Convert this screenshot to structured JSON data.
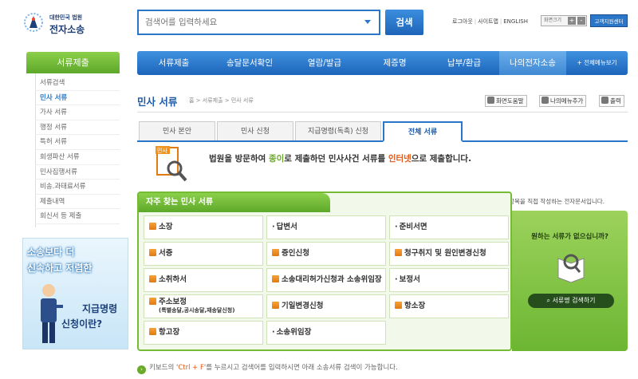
{
  "header": {
    "logo_top": "대한민국 법원",
    "logo_main": "전자소송",
    "search_placeholder": "검색어를 입력하세요",
    "search_button": "검색",
    "util_logout": "로그아웃",
    "util_sitemap": "사이트맵",
    "util_english": "ENGLISH",
    "font_size_label": "화면크기",
    "font_plus": "+",
    "font_minus": "-",
    "support_button": "고객지원센터"
  },
  "nav": {
    "items": [
      "서류제출",
      "송달문서확인",
      "열람/발급",
      "제증명",
      "납부/환급",
      "나의전자소송"
    ],
    "all_menu": "+ 전체메뉴보기"
  },
  "left_menu": {
    "title": "서류제출",
    "items": [
      "서류검색",
      "민사 서류",
      "가사 서류",
      "행정 서류",
      "특허 서류",
      "회생파산 서류",
      "민사집행서류",
      "비송.과태료서류",
      "제출내역",
      "회신서 등 제출"
    ],
    "active_index": 1
  },
  "banner": {
    "line1": "소송보다 더",
    "line2": "신속하고 저렴한",
    "line3": "지급명령",
    "line4": "신청이란?"
  },
  "page": {
    "title": "민사 서류",
    "breadcrumb": "홈 > 서류제출 > 민사 서류",
    "tools": [
      "화면도움말",
      "나의메뉴추가",
      "출력"
    ]
  },
  "tabs": {
    "items": [
      "민사 본안",
      "민사 신청",
      "지급명령(독촉) 신청",
      "전체 서류"
    ],
    "active_index": 3
  },
  "info": {
    "doc_label": "민사",
    "text_a": "법원을 방문하여 ",
    "text_b": "종이",
    "text_c": "로 제출하던 민사사건 서류를 ",
    "text_d": "인터넷",
    "text_e": "으로 제출합니다."
  },
  "note": "표시가 있는 문서는 표준화된 입력항목을 직접 작성하는 전자문서입니다.",
  "freq": {
    "title": "자주 찾는 민사 서류",
    "cells": [
      {
        "label": "소장",
        "icon": true
      },
      {
        "label": "답변서",
        "icon": false
      },
      {
        "label": "준비서면",
        "icon": false
      },
      {
        "label": "서증",
        "icon": true
      },
      {
        "label": "증인신청",
        "icon": true
      },
      {
        "label": "청구취지 및 원인변경신청",
        "icon": true
      },
      {
        "label": "소취하서",
        "icon": true
      },
      {
        "label": "소송대리허가신청과 소송위임장",
        "icon": true
      },
      {
        "label": "보정서",
        "icon": false
      },
      {
        "label": "주소보정",
        "sub": "(특별송달,공시송달,재송달신청)",
        "icon": true
      },
      {
        "label": "기일변경신청",
        "icon": true
      },
      {
        "label": "항소장",
        "icon": true
      },
      {
        "label": "항고장",
        "icon": true
      },
      {
        "label": "소송위임장",
        "icon": false
      }
    ]
  },
  "side": {
    "question": "원하는 서류가 없으십니까?",
    "button": "서류명 검색하기"
  },
  "footer": {
    "a": "키보드의 '",
    "key": "Ctrl + F",
    "b": "'를 누르시고 검색어를 입력하시면 아래 소송서류 검색이 가능합니다."
  },
  "colors": {
    "brand_blue": "#2a77c9",
    "brand_green": "#76bb34",
    "accent_orange": "#e05a1a"
  }
}
